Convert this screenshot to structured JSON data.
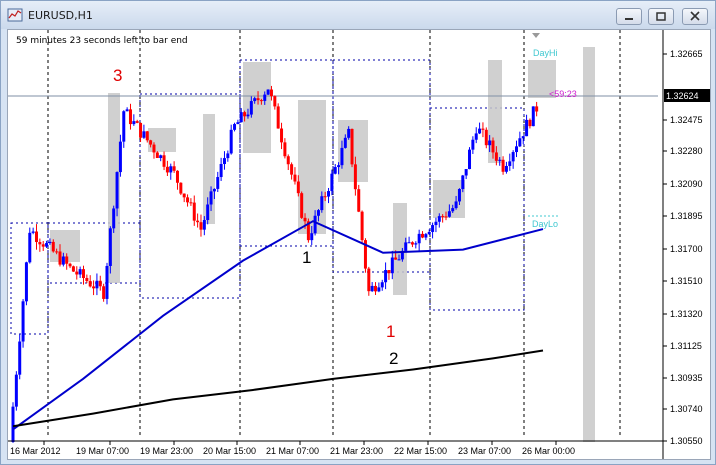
{
  "window": {
    "title": "EURUSD,H1",
    "icons": {
      "app": "chart-window-icon",
      "minimize": "minimize-icon",
      "maximize": "maximize-icon",
      "close": "close-icon"
    }
  },
  "chart": {
    "countdown_text": "59 minutes 23 seconds left to bar end",
    "timer_label": "<59:23",
    "current_price_label": "1.32624",
    "day_hi_label": "DayHi",
    "day_lo_label": "DayLo",
    "annotations": {
      "red_3": "3",
      "black_1": "1",
      "red_1": "1",
      "black_2": "2"
    },
    "colors": {
      "bull": "#0000ff",
      "bear": "#ff0000",
      "ma_blue": "#0000cc",
      "ma_black": "#000000",
      "price_line": "#7f8fa6",
      "timer": "#d020d0",
      "dayhilo": "#40c8d0",
      "annotation_red": "#e00000",
      "box_gray": "#c8c8c8"
    }
  },
  "chart_data": {
    "type": "candlestick",
    "title": "EURUSD,H1",
    "y_ticks": [
      "1.32665",
      "1.32624",
      "1.32475",
      "1.32280",
      "1.32090",
      "1.31895",
      "1.31700",
      "1.31510",
      "1.31320",
      "1.31125",
      "1.30935",
      "1.30740",
      "1.30550"
    ],
    "x_ticks": [
      "16 Mar 2012",
      "19 Mar 07:00",
      "19 Mar 23:00",
      "20 Mar 15:00",
      "21 Mar 07:00",
      "21 Mar 23:00",
      "22 Mar 15:00",
      "23 Mar 07:00",
      "26 Mar 00:00"
    ],
    "ylim": [
      1.305,
      1.3296
    ],
    "current_price": 1.32624,
    "ma_200": [
      [
        0,
        1.3058
      ],
      [
        70,
        1.309
      ],
      [
        150,
        1.313
      ],
      [
        230,
        1.3165
      ],
      [
        300,
        1.319
      ],
      [
        370,
        1.317
      ],
      [
        450,
        1.3172
      ],
      [
        530,
        1.3185
      ]
    ],
    "ma_long": [
      [
        0,
        1.306
      ],
      [
        80,
        1.3068
      ],
      [
        160,
        1.3077
      ],
      [
        240,
        1.3083
      ],
      [
        320,
        1.309
      ],
      [
        400,
        1.3096
      ],
      [
        480,
        1.3103
      ],
      [
        530,
        1.3108
      ]
    ],
    "candle_segments": [
      {
        "from": 1.305,
        "to": 1.3185,
        "count": 6
      },
      {
        "from": 1.3185,
        "to": 1.316,
        "count": 12
      },
      {
        "from": 1.316,
        "to": 1.3145,
        "count": 10
      },
      {
        "from": 1.3145,
        "to": 1.326,
        "count": 6
      },
      {
        "from": 1.326,
        "to": 1.322,
        "count": 15
      },
      {
        "from": 1.322,
        "to": 1.3185,
        "count": 8
      },
      {
        "from": 1.3185,
        "to": 1.325,
        "count": 10
      },
      {
        "from": 1.325,
        "to": 1.3275,
        "count": 10
      },
      {
        "from": 1.3275,
        "to": 1.318,
        "count": 12
      },
      {
        "from": 1.318,
        "to": 1.3245,
        "count": 12
      },
      {
        "from": 1.3245,
        "to": 1.3145,
        "count": 6
      },
      {
        "from": 1.3145,
        "to": 1.318,
        "count": 14
      },
      {
        "from": 1.318,
        "to": 1.32,
        "count": 12
      },
      {
        "from": 1.32,
        "to": 1.325,
        "count": 6
      },
      {
        "from": 1.325,
        "to": 1.3225,
        "count": 8
      },
      {
        "from": 1.3225,
        "to": 1.3262,
        "count": 10
      }
    ]
  }
}
